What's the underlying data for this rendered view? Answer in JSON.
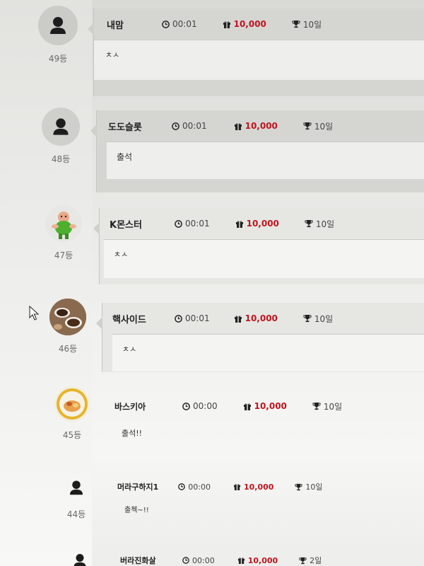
{
  "entries": [
    {
      "rank": "49등",
      "nick": "내맘",
      "time": "00:01",
      "points": "10,000",
      "trophy": "10일",
      "comment": "ㅊㅅ",
      "avatar": "default-user-icon"
    },
    {
      "rank": "48등",
      "nick": "도도슬롯",
      "time": "00:01",
      "points": "10,000",
      "trophy": "10일",
      "comment": "출석",
      "avatar": "default-user-icon"
    },
    {
      "rank": "47등",
      "nick": "K몬스터",
      "time": "00:01",
      "points": "10,000",
      "trophy": "10일",
      "comment": "ㅊㅅ",
      "avatar": "cartoon-character-photo"
    },
    {
      "rank": "46등",
      "nick": "핵사이드",
      "time": "00:01",
      "points": "10,000",
      "trophy": "10일",
      "comment": "ㅊㅅ",
      "avatar": "coffee-cups-photo"
    },
    {
      "rank": "45등",
      "nick": "바스키아",
      "time": "00:00",
      "points": "10,000",
      "trophy": "10일",
      "comment": "출석!!",
      "avatar": "gold-emblem-photo"
    },
    {
      "rank": "44등",
      "nick": "머라구하지1",
      "time": "00:00",
      "points": "10,000",
      "trophy": "10일",
      "comment": "출첵~!!",
      "avatar": "default-user-icon"
    },
    {
      "rank": "",
      "nick": "버라진화살",
      "time": "00:00",
      "points": "10,000",
      "trophy": "2일",
      "comment": "",
      "avatar": "default-user-icon"
    }
  ],
  "colors": {
    "points": "#c0141e",
    "card_header": "#d5d5d2",
    "card_body": "#eeeeec"
  }
}
